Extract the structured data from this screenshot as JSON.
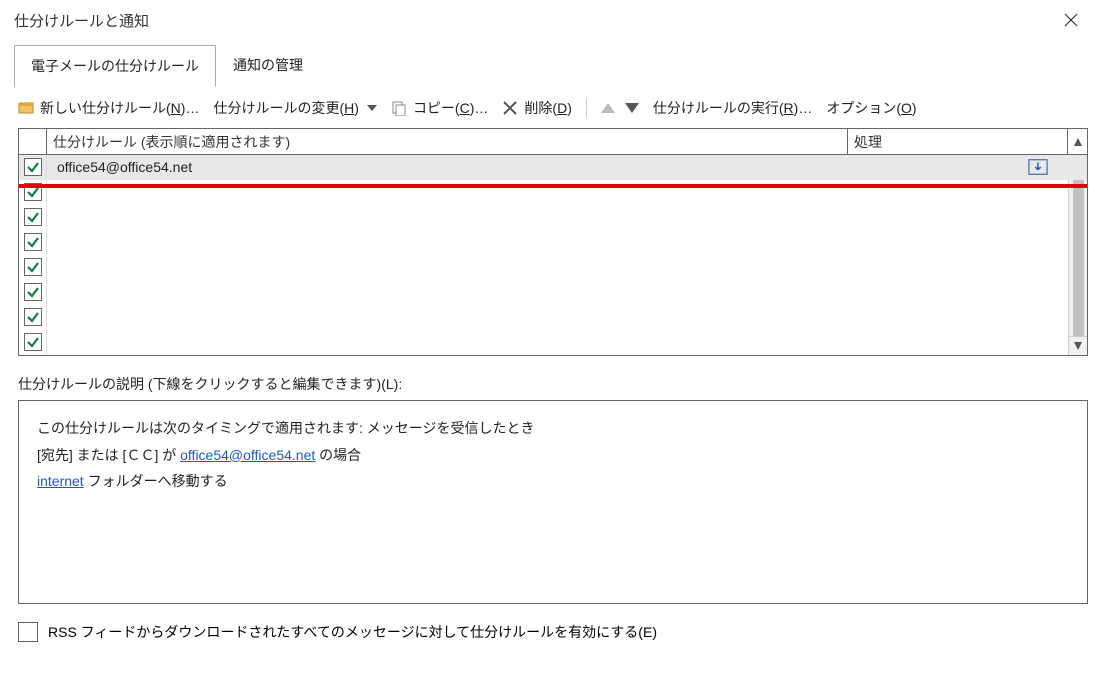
{
  "window": {
    "title": "仕分けルールと通知",
    "close": "✕"
  },
  "tabs": {
    "email": "電子メールの仕分けルール",
    "notify": "通知の管理"
  },
  "toolbar": {
    "newRule": "新しい仕分けルール(",
    "newRuleKey": "N",
    "newRuleEnd": ")…",
    "changeRule": "仕分けルールの変更(",
    "changeRuleKey": "H",
    "changeRuleEnd": ")",
    "copy": "コピー(",
    "copyKey": "C",
    "copyEnd": ")…",
    "delete": "削除(",
    "deleteKey": "D",
    "deleteEnd": ")",
    "runRules": "仕分けルールの実行(",
    "runRulesKey": "R",
    "runRulesEnd": ")…",
    "options": "オプション(",
    "optionsKey": "O",
    "optionsEnd": ")"
  },
  "listHeader": {
    "ruleName": "仕分けルール (表示順に適用されます)",
    "action": "処理"
  },
  "rules": {
    "selected": {
      "name": "office54@office54.net"
    }
  },
  "description": {
    "label": "仕分けルールの説明 (下線をクリックすると編集できます)(",
    "labelKey": "L",
    "labelEnd": "):",
    "line1": "この仕分けルールは次のタイミングで適用されます: メッセージを受信したとき",
    "line2a": "[宛先] または [ＣＣ] が ",
    "line2link": "office54@office54.net",
    "line2b": " の場合",
    "line3link": "internet",
    "line3b": " フォルダーへ移動する"
  },
  "rss": {
    "label": "RSS フィードからダウンロードされたすべてのメッセージに対して仕分けルールを有効にする(",
    "key": "E",
    "end": ")"
  }
}
